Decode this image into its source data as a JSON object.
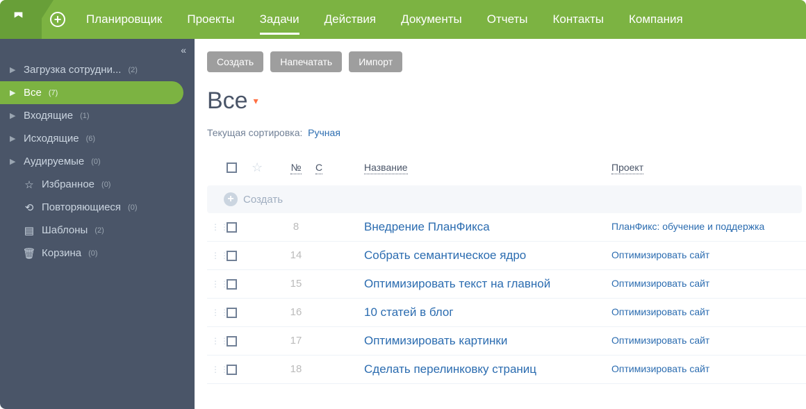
{
  "nav": {
    "items": [
      "Планировщик",
      "Проекты",
      "Задачи",
      "Действия",
      "Документы",
      "Отчеты",
      "Контакты",
      "Компания"
    ],
    "active_index": 2
  },
  "sidebar": {
    "items": [
      {
        "label": "Загрузка сотрудни...",
        "count": "(2)",
        "expandable": true,
        "icon": null
      },
      {
        "label": "Все",
        "count": "(7)",
        "expandable": true,
        "active": true,
        "icon": null
      },
      {
        "label": "Входящие",
        "count": "(1)",
        "expandable": true,
        "icon": null
      },
      {
        "label": "Исходящие",
        "count": "(6)",
        "expandable": true,
        "icon": null
      },
      {
        "label": "Аудируемые",
        "count": "(0)",
        "expandable": true,
        "icon": null
      },
      {
        "label": "Избранное",
        "count": "(0)",
        "expandable": false,
        "icon": "star"
      },
      {
        "label": "Повторяющиеся",
        "count": "(0)",
        "expandable": false,
        "icon": "repeat"
      },
      {
        "label": "Шаблоны",
        "count": "(2)",
        "expandable": false,
        "icon": "template"
      },
      {
        "label": "Корзина",
        "count": "(0)",
        "expandable": false,
        "icon": "trash"
      }
    ]
  },
  "toolbar": {
    "create": "Создать",
    "print": "Напечатать",
    "import": "Импорт"
  },
  "page": {
    "title": "Все",
    "sort_label": "Текущая сортировка:",
    "sort_value": "Ручная"
  },
  "table": {
    "headers": {
      "num": "№",
      "c": "С",
      "name": "Название",
      "project": "Проект"
    },
    "create_label": "Создать",
    "rows": [
      {
        "num": "8",
        "name": "Внедрение ПланФикса",
        "project": "ПланФикс: обучение и поддержка"
      },
      {
        "num": "14",
        "name": "Собрать семантическое ядро",
        "project": "Оптимизировать сайт"
      },
      {
        "num": "15",
        "name": "Оптимизировать текст на главной",
        "project": "Оптимизировать сайт"
      },
      {
        "num": "16",
        "name": "10 статей в блог",
        "project": "Оптимизировать сайт"
      },
      {
        "num": "17",
        "name": "Оптимизировать картинки",
        "project": "Оптимизировать сайт"
      },
      {
        "num": "18",
        "name": "Сделать перелинковку страниц",
        "project": "Оптимизировать сайт"
      }
    ]
  }
}
